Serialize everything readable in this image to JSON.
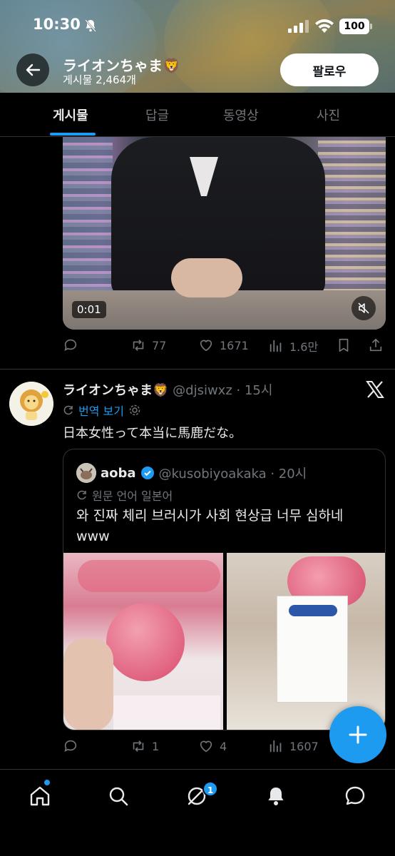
{
  "status_bar": {
    "time": "10:30",
    "battery": "100"
  },
  "header": {
    "profile_name": "ライオンちゃま🦁",
    "post_count": "게시물 2,464개",
    "follow_label": "팔로우"
  },
  "tabs": [
    {
      "label": "게시물",
      "active": true
    },
    {
      "label": "답글",
      "active": false
    },
    {
      "label": "동영상",
      "active": false
    },
    {
      "label": "사진",
      "active": false
    }
  ],
  "post1": {
    "video_time": "0:01",
    "actions": {
      "retweets": "77",
      "likes": "1671",
      "views": "1.6만"
    }
  },
  "post2": {
    "author_name": "ライオンちゃま🦁",
    "author_meta": "@djsiwxz · 15시",
    "translate_label": "번역 보기",
    "text": "日本女性って本当に馬鹿だな。",
    "quote": {
      "name": "aoba",
      "meta": "@kusobiyoakaka · 20시",
      "lang": "원문 언어 일본어",
      "text": "와 진짜 체리 브러시가 사회 현상급 너무 심하네 www"
    },
    "actions": {
      "retweets": "1",
      "likes": "4",
      "views": "1607"
    }
  },
  "bottom_nav": {
    "messages_badge": "1"
  },
  "colors": {
    "accent": "#1d9bf0",
    "background": "#000000",
    "muted": "#71767b",
    "text": "#e7e9ea"
  },
  "icons": [
    "bell-off-icon",
    "signal-icon",
    "wifi-icon",
    "back-arrow-icon",
    "mute-icon",
    "reply-icon",
    "retweet-icon",
    "like-icon",
    "views-icon",
    "bookmark-icon",
    "share-icon",
    "x-logo-icon",
    "translate-icon",
    "settings-icon",
    "verified-icon",
    "plus-icon",
    "home-icon",
    "search-icon",
    "grok-icon",
    "notifications-icon",
    "messages-icon"
  ]
}
